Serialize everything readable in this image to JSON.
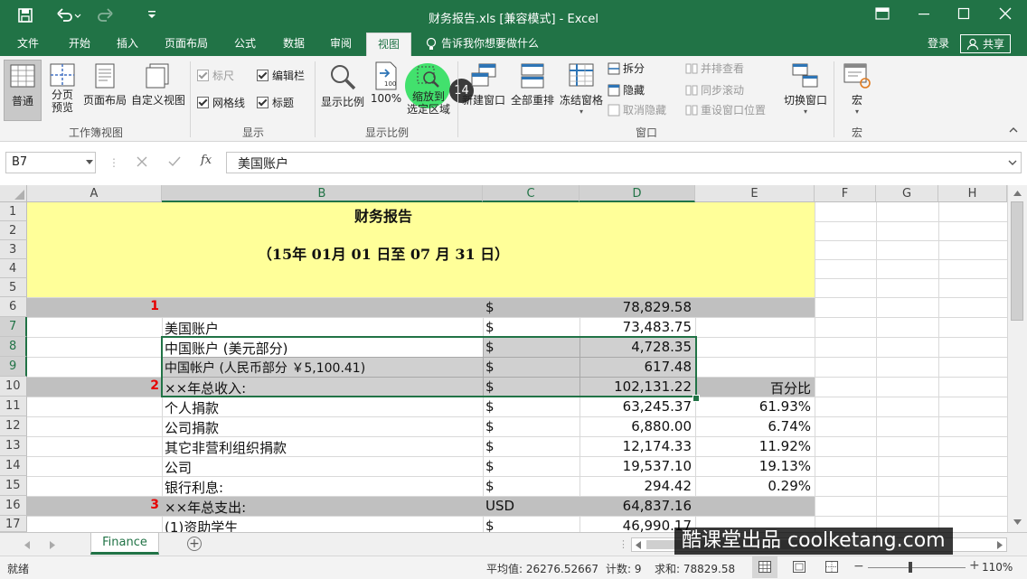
{
  "window": {
    "title": "财务报告.xls  [兼容模式] - Excel"
  },
  "tabs": [
    {
      "label": "文件"
    },
    {
      "label": "开始"
    },
    {
      "label": "插入"
    },
    {
      "label": "页面布局"
    },
    {
      "label": "公式"
    },
    {
      "label": "数据"
    },
    {
      "label": "审阅"
    },
    {
      "label": "视图"
    }
  ],
  "tell_me": "告诉我你想要做什么",
  "login": "登录",
  "share": "共享",
  "ribbon": {
    "workbook_views": {
      "label": "工作簿视图",
      "normal": "普通",
      "page_break_1": "分页",
      "page_break_2": "预览",
      "page_layout": "页面布局",
      "custom_view": "自定义视图"
    },
    "show": {
      "label": "显示",
      "ruler": "标尺",
      "formula_bar": "编辑栏",
      "gridlines": "网格线",
      "headings": "标题"
    },
    "zoom": {
      "label": "显示比例",
      "zoom": "显示比例",
      "hundred": "100%",
      "hundred_icon_text": "100",
      "zoom_sel_1": "缩放到",
      "zoom_sel_2": "选定区域",
      "badge": "14"
    },
    "window": {
      "label": "窗口",
      "new_window": "新建窗口",
      "arrange_all": "全部重排",
      "freeze": "冻结窗格",
      "split": "拆分",
      "hide": "隐藏",
      "unhide": "取消隐藏",
      "side_by_side": "并排查看",
      "sync_scroll": "同步滚动",
      "reset_pos": "重设窗口位置",
      "switch": "切换窗口"
    },
    "macros": {
      "label": "宏",
      "macro": "宏"
    }
  },
  "formula_bar": {
    "name_box": "B7",
    "fx": "fx",
    "content": "美国账户"
  },
  "columns": [
    "A",
    "B",
    "C",
    "D",
    "E",
    "F",
    "G",
    "H"
  ],
  "rows": [
    {
      "num": "1",
      "b": "财务报告"
    },
    {
      "num": "2"
    },
    {
      "num": "3",
      "b": "（15年  01月  01  日至  07  月  31  日）"
    },
    {
      "num": "4"
    },
    {
      "num": "5"
    },
    {
      "num": "6",
      "a": "1",
      "c": "$",
      "d": "78,829.58"
    },
    {
      "num": "7",
      "b": "美国账户",
      "c": "$",
      "d": "73,483.75"
    },
    {
      "num": "8",
      "b": "中国账户 (美元部分)",
      "c": "$",
      "d": "4,728.35"
    },
    {
      "num": "9",
      "b": "中国帐户 (人民币部分 ￥5,100.41)",
      "c": "$",
      "d": "617.48"
    },
    {
      "num": "10",
      "a": "2",
      "b": "××年总收入:",
      "c": "$",
      "d": "102,131.22",
      "e": "百分比"
    },
    {
      "num": "11",
      "b": "个人捐款",
      "c": "$",
      "d": "63,245.37",
      "e": "61.93%"
    },
    {
      "num": "12",
      "b": "公司捐款",
      "c": "$",
      "d": "6,880.00",
      "e": "6.74%"
    },
    {
      "num": "13",
      "b": "其它非营利组织捐款",
      "c": "$",
      "d": "12,174.33",
      "e": "11.92%"
    },
    {
      "num": "14",
      "b": "公司",
      "c": "$",
      "d": "19,537.10",
      "e": "19.13%"
    },
    {
      "num": "15",
      "b": "银行利息:",
      "c": "$",
      "d": "294.42",
      "e": "0.29%"
    },
    {
      "num": "16",
      "a": "3",
      "b": "××年总支出:",
      "c": "USD",
      "d": "64,837.16"
    },
    {
      "num": "17",
      "b": "(1)资助学生",
      "c": "$",
      "d": "46,990.17"
    }
  ],
  "sheet_tab": "Finance",
  "status": {
    "ready": "就绪",
    "average": "平均值: 26276.52667",
    "count": "计数: 9",
    "sum": "求和: 78829.58",
    "zoom": "110%"
  },
  "watermark": "酷课堂出品 coolketang.com",
  "colors": {
    "excel_green": "#217346",
    "header_yellow": "#ffff99",
    "gray_band": "#c0c0c0",
    "red_num": "#e60000",
    "badge": "#3b3b3b",
    "highlight_circle": "#22dd55"
  }
}
